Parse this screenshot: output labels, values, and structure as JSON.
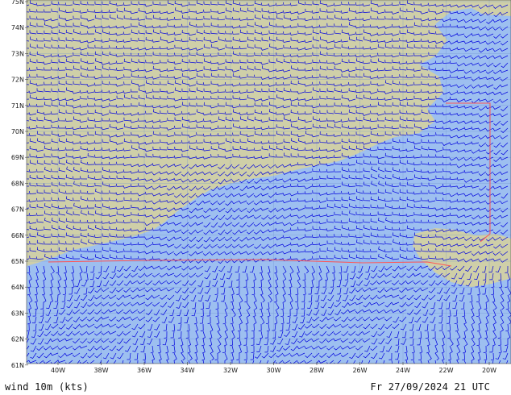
{
  "title_left": "wind 10m (kts)",
  "title_right": "Fr 27/09/2024 21 UTC",
  "lat_labels": [
    "75N",
    "74N",
    "73N",
    "72N",
    "71N",
    "70N",
    "69N",
    "68N",
    "67N",
    "66N",
    "65N",
    "64N",
    "63N",
    "62N",
    "61N"
  ],
  "lon_labels": [
    "40W",
    "38W",
    "36W",
    "34W",
    "32W",
    "30W",
    "28W",
    "26W",
    "24W",
    "22W",
    "20W"
  ],
  "colors": {
    "ocean": "#9dbff0",
    "land": "#cfcfa8",
    "barbs": "#0000dd",
    "border_line": "#ff5555",
    "grid": "#6d8fd0"
  }
}
